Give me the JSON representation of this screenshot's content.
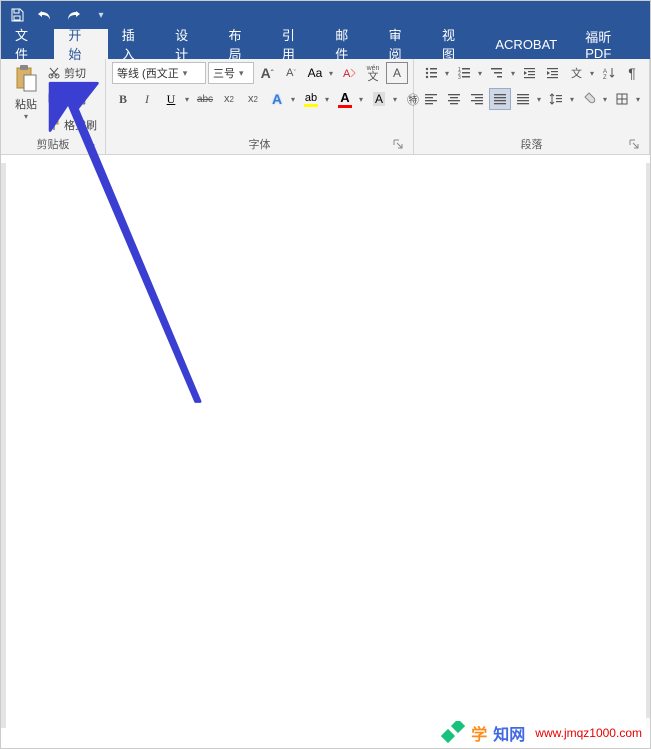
{
  "titlebar": {
    "save": "保存",
    "undo": "撤销",
    "redo": "恢复",
    "customize": "自定义"
  },
  "menu": {
    "file": "文件",
    "home": "开始",
    "insert": "插入",
    "design": "设计",
    "layout": "布局",
    "references": "引用",
    "mailings": "邮件",
    "review": "审阅",
    "view": "视图",
    "acrobat": "ACROBAT",
    "foxit": "福昕PDF"
  },
  "ribbon": {
    "clipboard": {
      "paste": "粘贴",
      "cut": "剪切",
      "copy": "复制",
      "format_painter": "格式刷",
      "label": "剪贴板"
    },
    "font": {
      "name": "等线 (西文正",
      "size": "三号",
      "grow": "A",
      "shrink": "A",
      "case": "Aa",
      "clear": "",
      "phonetic": "wén",
      "char_border": "A",
      "bold": "B",
      "italic": "I",
      "underline": "U",
      "strike": "abc",
      "subscript": "x₂",
      "superscript": "x²",
      "text_effects": "A",
      "highlight": "A",
      "font_color": "A",
      "char_shading": "A",
      "enclose": "㊕",
      "label": "字体"
    },
    "paragraph": {
      "label": "段落"
    }
  },
  "watermark": {
    "text1": "学",
    "text2": "知网",
    "url": "www.jmqz1000.com"
  }
}
